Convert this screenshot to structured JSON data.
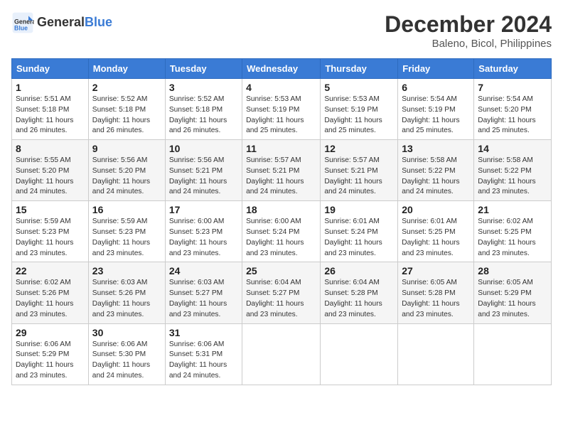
{
  "header": {
    "logo_line1": "General",
    "logo_line2": "Blue",
    "month": "December 2024",
    "location": "Baleno, Bicol, Philippines"
  },
  "columns": [
    "Sunday",
    "Monday",
    "Tuesday",
    "Wednesday",
    "Thursday",
    "Friday",
    "Saturday"
  ],
  "weeks": [
    [
      {
        "day": "1",
        "sunrise": "Sunrise: 5:51 AM",
        "sunset": "Sunset: 5:18 PM",
        "daylight": "Daylight: 11 hours and 26 minutes."
      },
      {
        "day": "2",
        "sunrise": "Sunrise: 5:52 AM",
        "sunset": "Sunset: 5:18 PM",
        "daylight": "Daylight: 11 hours and 26 minutes."
      },
      {
        "day": "3",
        "sunrise": "Sunrise: 5:52 AM",
        "sunset": "Sunset: 5:18 PM",
        "daylight": "Daylight: 11 hours and 26 minutes."
      },
      {
        "day": "4",
        "sunrise": "Sunrise: 5:53 AM",
        "sunset": "Sunset: 5:19 PM",
        "daylight": "Daylight: 11 hours and 25 minutes."
      },
      {
        "day": "5",
        "sunrise": "Sunrise: 5:53 AM",
        "sunset": "Sunset: 5:19 PM",
        "daylight": "Daylight: 11 hours and 25 minutes."
      },
      {
        "day": "6",
        "sunrise": "Sunrise: 5:54 AM",
        "sunset": "Sunset: 5:19 PM",
        "daylight": "Daylight: 11 hours and 25 minutes."
      },
      {
        "day": "7",
        "sunrise": "Sunrise: 5:54 AM",
        "sunset": "Sunset: 5:20 PM",
        "daylight": "Daylight: 11 hours and 25 minutes."
      }
    ],
    [
      {
        "day": "8",
        "sunrise": "Sunrise: 5:55 AM",
        "sunset": "Sunset: 5:20 PM",
        "daylight": "Daylight: 11 hours and 24 minutes."
      },
      {
        "day": "9",
        "sunrise": "Sunrise: 5:56 AM",
        "sunset": "Sunset: 5:20 PM",
        "daylight": "Daylight: 11 hours and 24 minutes."
      },
      {
        "day": "10",
        "sunrise": "Sunrise: 5:56 AM",
        "sunset": "Sunset: 5:21 PM",
        "daylight": "Daylight: 11 hours and 24 minutes."
      },
      {
        "day": "11",
        "sunrise": "Sunrise: 5:57 AM",
        "sunset": "Sunset: 5:21 PM",
        "daylight": "Daylight: 11 hours and 24 minutes."
      },
      {
        "day": "12",
        "sunrise": "Sunrise: 5:57 AM",
        "sunset": "Sunset: 5:21 PM",
        "daylight": "Daylight: 11 hours and 24 minutes."
      },
      {
        "day": "13",
        "sunrise": "Sunrise: 5:58 AM",
        "sunset": "Sunset: 5:22 PM",
        "daylight": "Daylight: 11 hours and 24 minutes."
      },
      {
        "day": "14",
        "sunrise": "Sunrise: 5:58 AM",
        "sunset": "Sunset: 5:22 PM",
        "daylight": "Daylight: 11 hours and 23 minutes."
      }
    ],
    [
      {
        "day": "15",
        "sunrise": "Sunrise: 5:59 AM",
        "sunset": "Sunset: 5:23 PM",
        "daylight": "Daylight: 11 hours and 23 minutes."
      },
      {
        "day": "16",
        "sunrise": "Sunrise: 5:59 AM",
        "sunset": "Sunset: 5:23 PM",
        "daylight": "Daylight: 11 hours and 23 minutes."
      },
      {
        "day": "17",
        "sunrise": "Sunrise: 6:00 AM",
        "sunset": "Sunset: 5:23 PM",
        "daylight": "Daylight: 11 hours and 23 minutes."
      },
      {
        "day": "18",
        "sunrise": "Sunrise: 6:00 AM",
        "sunset": "Sunset: 5:24 PM",
        "daylight": "Daylight: 11 hours and 23 minutes."
      },
      {
        "day": "19",
        "sunrise": "Sunrise: 6:01 AM",
        "sunset": "Sunset: 5:24 PM",
        "daylight": "Daylight: 11 hours and 23 minutes."
      },
      {
        "day": "20",
        "sunrise": "Sunrise: 6:01 AM",
        "sunset": "Sunset: 5:25 PM",
        "daylight": "Daylight: 11 hours and 23 minutes."
      },
      {
        "day": "21",
        "sunrise": "Sunrise: 6:02 AM",
        "sunset": "Sunset: 5:25 PM",
        "daylight": "Daylight: 11 hours and 23 minutes."
      }
    ],
    [
      {
        "day": "22",
        "sunrise": "Sunrise: 6:02 AM",
        "sunset": "Sunset: 5:26 PM",
        "daylight": "Daylight: 11 hours and 23 minutes."
      },
      {
        "day": "23",
        "sunrise": "Sunrise: 6:03 AM",
        "sunset": "Sunset: 5:26 PM",
        "daylight": "Daylight: 11 hours and 23 minutes."
      },
      {
        "day": "24",
        "sunrise": "Sunrise: 6:03 AM",
        "sunset": "Sunset: 5:27 PM",
        "daylight": "Daylight: 11 hours and 23 minutes."
      },
      {
        "day": "25",
        "sunrise": "Sunrise: 6:04 AM",
        "sunset": "Sunset: 5:27 PM",
        "daylight": "Daylight: 11 hours and 23 minutes."
      },
      {
        "day": "26",
        "sunrise": "Sunrise: 6:04 AM",
        "sunset": "Sunset: 5:28 PM",
        "daylight": "Daylight: 11 hours and 23 minutes."
      },
      {
        "day": "27",
        "sunrise": "Sunrise: 6:05 AM",
        "sunset": "Sunset: 5:28 PM",
        "daylight": "Daylight: 11 hours and 23 minutes."
      },
      {
        "day": "28",
        "sunrise": "Sunrise: 6:05 AM",
        "sunset": "Sunset: 5:29 PM",
        "daylight": "Daylight: 11 hours and 23 minutes."
      }
    ],
    [
      {
        "day": "29",
        "sunrise": "Sunrise: 6:06 AM",
        "sunset": "Sunset: 5:29 PM",
        "daylight": "Daylight: 11 hours and 23 minutes."
      },
      {
        "day": "30",
        "sunrise": "Sunrise: 6:06 AM",
        "sunset": "Sunset: 5:30 PM",
        "daylight": "Daylight: 11 hours and 24 minutes."
      },
      {
        "day": "31",
        "sunrise": "Sunrise: 6:06 AM",
        "sunset": "Sunset: 5:31 PM",
        "daylight": "Daylight: 11 hours and 24 minutes."
      },
      null,
      null,
      null,
      null
    ]
  ]
}
